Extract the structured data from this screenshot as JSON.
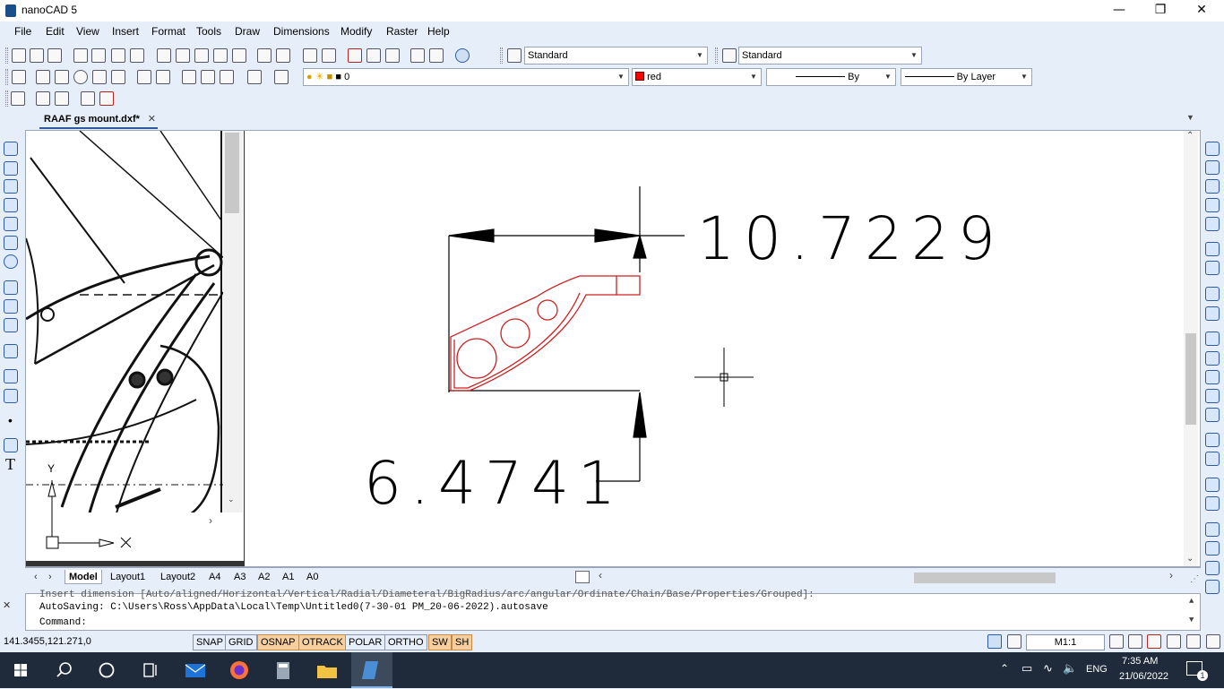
{
  "app": {
    "title": "nanoCAD 5"
  },
  "menu": [
    "File",
    "Edit",
    "View",
    "Insert",
    "Format",
    "Tools",
    "Draw",
    "Dimensions",
    "Modify",
    "Raster",
    "Help"
  ],
  "toolbar": {
    "text_style": "Standard",
    "dim_style": "Standard",
    "layer": "0",
    "color": "red",
    "color_hex": "#ff0000",
    "linetype": "By Layer",
    "lineweight": "By Layer"
  },
  "document": {
    "tab_label": "RAAF gs mount.dxf*"
  },
  "drawing": {
    "dim_horizontal": "10.7229",
    "dim_vertical": "6.4741",
    "ucs_y": "Y",
    "ucs_x": "X",
    "part_color": "#cc2222"
  },
  "layout_tabs": [
    "Model",
    "Layout1",
    "Layout2",
    "A4",
    "A3",
    "A2",
    "A1",
    "A0"
  ],
  "command": {
    "line1": "Insert dimension [Auto/aligned/Horizontal/Vertical/Radial/Diameteral/BigRadius/arc/angular/Ordinate/Chain/Base/Properties/Grouped]:",
    "line2": "AutoSaving: C:\\Users\\Ross\\AppData\\Local\\Temp\\Untitled0(7-30-01 PM_20-06-2022).autosave",
    "prompt": "Command:"
  },
  "status": {
    "coords": "141.3455,121.271,0",
    "modes": [
      {
        "label": "SNAP",
        "on": false
      },
      {
        "label": "GRID",
        "on": false
      },
      {
        "label": "OSNAP",
        "on": true
      },
      {
        "label": "OTRACK",
        "on": true
      },
      {
        "label": "POLAR",
        "on": false
      },
      {
        "label": "ORTHO",
        "on": false
      },
      {
        "label": "SW",
        "on": true
      },
      {
        "label": "SH",
        "on": true
      }
    ],
    "scale": "M1:1"
  },
  "taskbar": {
    "language": "ENG",
    "time": "7:35 AM",
    "date": "21/06/2022",
    "notifications": "1"
  }
}
